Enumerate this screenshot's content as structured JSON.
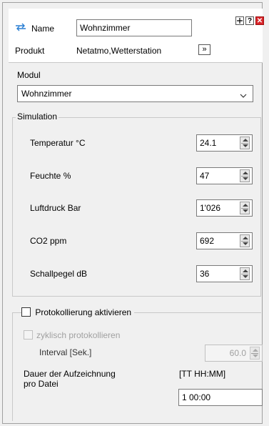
{
  "header": {
    "name_label": "Name",
    "name_value": "Wohnzimmer",
    "product_label": "Produkt",
    "product_value": "Netatmo,Wetterstation",
    "expand_button": "»",
    "help_button": "?",
    "close_button": "✕"
  },
  "module": {
    "label": "Modul",
    "selected": "Wohnzimmer"
  },
  "simulation": {
    "legend": "Simulation",
    "rows": [
      {
        "label": "Temperatur °C",
        "value": "24.1"
      },
      {
        "label": "Feuchte %",
        "value": "47"
      },
      {
        "label": "Luftdruck Bar",
        "value": "1'026"
      },
      {
        "label": "CO2 ppm",
        "value": "692"
      },
      {
        "label": "Schallpegel dB",
        "value": "36"
      }
    ]
  },
  "logging": {
    "activate_label": "Protokollierung aktivieren",
    "cyclic_label": "zyklisch protokollieren",
    "interval_label": "Interval [Sek.]",
    "interval_value": "60.0",
    "duration_label_line1": "Dauer der Aufzeichnung",
    "duration_label_line2": "pro Datei",
    "duration_format": "[TT HH:MM]",
    "duration_value": "1 00:00"
  },
  "colors": {
    "icon_blue": "#2a7fd4",
    "close_red": "#d9262b"
  }
}
